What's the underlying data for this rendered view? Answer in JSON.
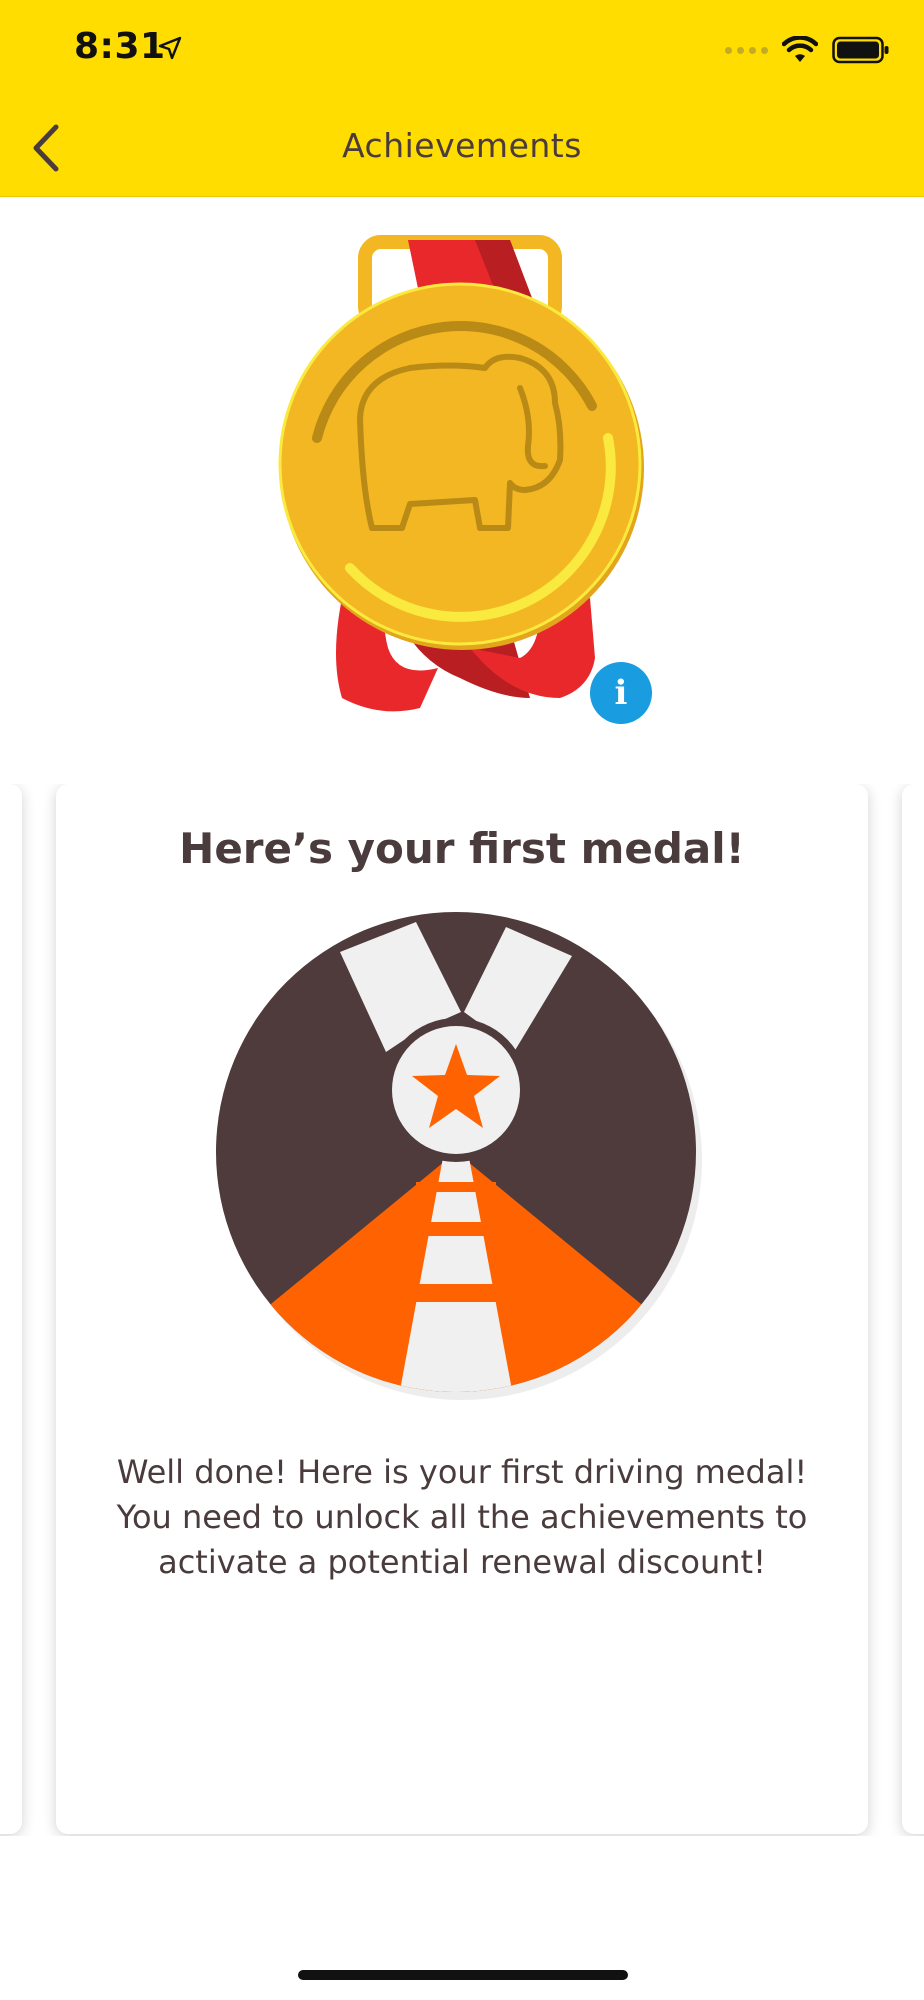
{
  "status_bar": {
    "time": "8:31"
  },
  "nav": {
    "title": "Achievements",
    "back_icon": "chevron-left-icon"
  },
  "hero": {
    "medal_icon": "gold-medal-elephant-icon",
    "info_label": "i",
    "colors": {
      "gold": "#F2B722",
      "ribbon": "#E8282B",
      "info": "#1A9CE0"
    }
  },
  "card": {
    "title": "Here’s your first medal!",
    "badge_icon": "first-medal-road-badge-icon",
    "body": "Well done! Here is your first driving medal! You need to unlock all the achievements to activate a potential renewal discount!",
    "colors": {
      "dark": "#4F3A3C",
      "road": "#FF6200",
      "light": "#F0F0F0"
    }
  },
  "theme": {
    "header_bg": "#FFDD00",
    "text": "#4A3B3D"
  }
}
